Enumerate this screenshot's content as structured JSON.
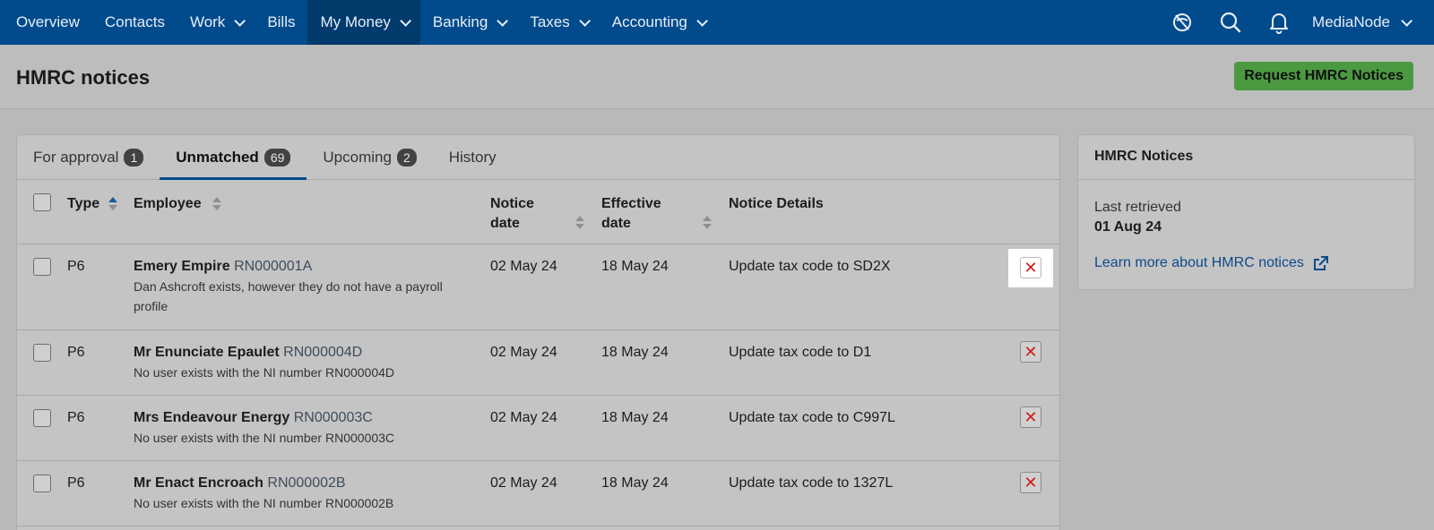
{
  "nav": {
    "items": [
      {
        "label": "Overview",
        "dropdown": false,
        "active": false
      },
      {
        "label": "Contacts",
        "dropdown": false,
        "active": false
      },
      {
        "label": "Work",
        "dropdown": true,
        "active": false
      },
      {
        "label": "Bills",
        "dropdown": false,
        "active": false
      },
      {
        "label": "My Money",
        "dropdown": true,
        "active": true
      },
      {
        "label": "Banking",
        "dropdown": true,
        "active": false
      },
      {
        "label": "Taxes",
        "dropdown": true,
        "active": false
      },
      {
        "label": "Accounting",
        "dropdown": true,
        "active": false
      }
    ],
    "icons": [
      "no-tracking-icon",
      "search-icon",
      "bell-icon"
    ],
    "user": "MediaNode"
  },
  "header": {
    "title": "HMRC notices",
    "request_button": "Request HMRC Notices"
  },
  "tabs": [
    {
      "label": "For approval",
      "count": "1",
      "active": false
    },
    {
      "label": "Unmatched",
      "count": "69",
      "active": true
    },
    {
      "label": "Upcoming",
      "count": "2",
      "active": false
    },
    {
      "label": "History",
      "count": null,
      "active": false
    }
  ],
  "table": {
    "headers": {
      "type": "Type",
      "employee": "Employee",
      "notice_date_1": "Notice",
      "notice_date_2": "date",
      "effective_date_1": "Effective",
      "effective_date_2": "date",
      "details": "Notice Details"
    },
    "rows": [
      {
        "type": "P6",
        "name": "Emery Empire",
        "ni": "RN000001A",
        "note": "Dan Ashcroft exists, however they do not have a payroll profile",
        "notice_date": "02 May 24",
        "effective_date": "18 May 24",
        "details": "Update tax code to SD2X",
        "delete": "✕"
      },
      {
        "type": "P6",
        "name": "Mr Enunciate Epaulet",
        "ni": "RN000004D",
        "note": "No user exists with the NI number RN000004D",
        "notice_date": "02 May 24",
        "effective_date": "18 May 24",
        "details": "Update tax code to D1",
        "delete": "✕"
      },
      {
        "type": "P6",
        "name": "Mrs Endeavour Energy",
        "ni": "RN000003C",
        "note": "No user exists with the NI number RN000003C",
        "notice_date": "02 May 24",
        "effective_date": "18 May 24",
        "details": "Update tax code to C997L",
        "delete": "✕"
      },
      {
        "type": "P6",
        "name": "Mr Enact Encroach",
        "ni": "RN000002B",
        "note": "No user exists with the NI number RN000002B",
        "notice_date": "02 May 24",
        "effective_date": "18 May 24",
        "details": "Update tax code to 1327L",
        "delete": "✕"
      }
    ]
  },
  "side": {
    "title": "HMRC Notices",
    "last_retrieved_label": "Last retrieved",
    "last_retrieved_value": "01 Aug 24",
    "learn_more": "Learn more about HMRC notices"
  },
  "colors": {
    "nav_bg": "#014b8c",
    "primary_button": "#4b9a41",
    "delete_icon": "#d01a1a",
    "link": "#0d4a8a"
  }
}
